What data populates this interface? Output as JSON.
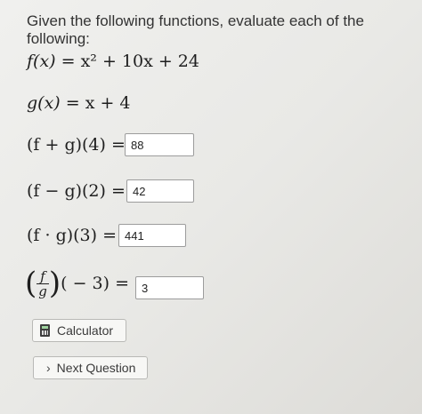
{
  "prompt": "Given the following functions, evaluate each of the following:",
  "functions": {
    "f": {
      "lhs": "f(x)",
      "rhs": "= x² + 10x + 24"
    },
    "g": {
      "lhs": "g(x)",
      "rhs": "= x + 4"
    }
  },
  "questions": {
    "q1": {
      "expr": "(f + g)(4) =",
      "answer": "88"
    },
    "q2": {
      "expr": "(f − g)(2) =",
      "answer": "42"
    },
    "q3": {
      "expr": "(f · g)(3) =",
      "answer": "441"
    },
    "q4": {
      "num": "f",
      "den": "g",
      "arg": "( − 3) =",
      "answer": "3"
    }
  },
  "buttons": {
    "calculator": "Calculator",
    "next": "Next Question"
  },
  "icons": {
    "calculator": "calculator-icon",
    "next": "chevron-right-icon"
  }
}
